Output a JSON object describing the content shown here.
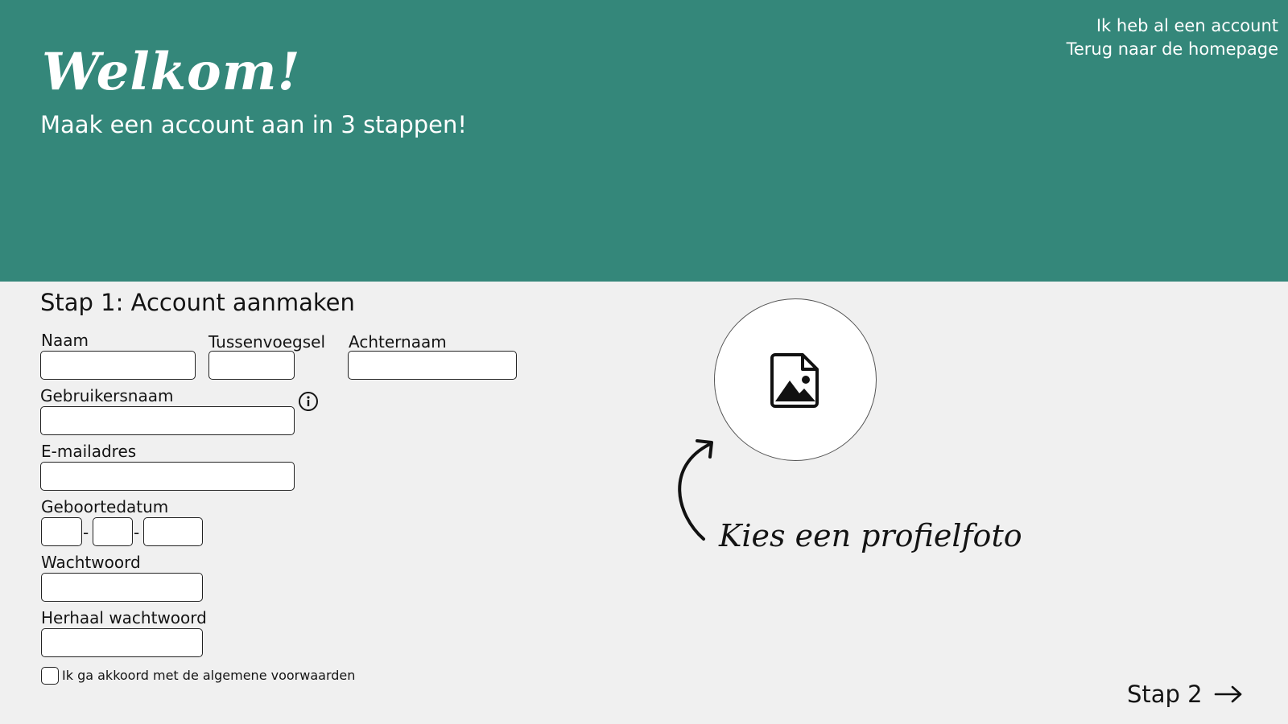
{
  "header": {
    "title": "Welkom!",
    "subtitle": "Maak een account aan in 3 stappen!",
    "links": {
      "login": "Ik heb al een account",
      "home": "Terug naar de homepage"
    },
    "background_color": "#34877a"
  },
  "form": {
    "step_title": "Stap 1: Account aanmaken",
    "labels": {
      "first_name": "Naam",
      "infix": "Tussenvoegsel",
      "last_name": "Achternaam",
      "username": "Gebruikersnaam",
      "email": "E-mailadres",
      "birthdate": "Geboortedatum",
      "password": "Wachtwoord",
      "repeat_password": "Herhaal wachtwoord"
    },
    "values": {
      "first_name": "",
      "infix": "",
      "last_name": "",
      "username": "",
      "email": "",
      "birth_day": "",
      "birth_month": "",
      "birth_year": "",
      "password": "",
      "repeat_password": ""
    },
    "date_separator": "-",
    "terms_label": "Ik ga akkoord met de algemene voorwaarden",
    "terms_checked": false,
    "username_info_icon": "info-icon"
  },
  "profile_photo": {
    "hint": "Kies een profielfoto",
    "icon": "image-file-icon"
  },
  "navigation": {
    "next_label": "Stap 2",
    "next_icon": "arrow-right-icon"
  }
}
